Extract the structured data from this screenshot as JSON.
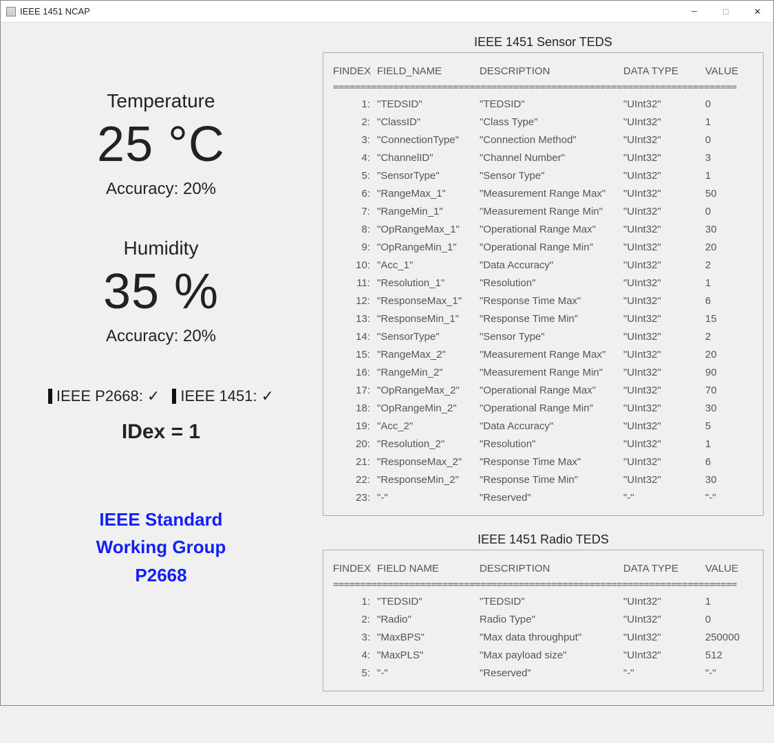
{
  "window": {
    "title": "IEEE 1451 NCAP"
  },
  "readings": {
    "temperature": {
      "label": "Temperature",
      "value": "25  °C",
      "accuracy": "Accuracy: 20%"
    },
    "humidity": {
      "label": "Humidity",
      "value": "35  %",
      "accuracy": "Accuracy: 20%"
    }
  },
  "status": {
    "p2668": {
      "label": "IEEE P2668:",
      "value": "✓"
    },
    "i1451": {
      "label": "IEEE 1451:",
      "value": "✓"
    },
    "idex": "IDex =   1"
  },
  "branding": {
    "line1": "IEEE Standard",
    "line2": "Working Group",
    "line3": "P2668"
  },
  "sensor_teds": {
    "title": "IEEE 1451 Sensor TEDS",
    "columns": [
      "FINDEX",
      "FIELD_NAME",
      "DESCRIPTION",
      "DATA TYPE",
      "VALUE"
    ],
    "rows": [
      {
        "idx": "1:",
        "name": "\"TEDSID\"",
        "desc": "\"TEDSID\"",
        "type": "\"UInt32\"",
        "value": "0"
      },
      {
        "idx": "2:",
        "name": "\"ClassID\"",
        "desc": "\"Class Type\"",
        "type": "\"UInt32\"",
        "value": "1"
      },
      {
        "idx": "3:",
        "name": "\"ConnectionType\"",
        "desc": "\"Connection Method\"",
        "type": "\"UInt32\"",
        "value": "0"
      },
      {
        "idx": "4:",
        "name": "\"ChannelID\"",
        "desc": "\"Channel Number\"",
        "type": "\"UInt32\"",
        "value": "3"
      },
      {
        "idx": "5:",
        "name": "\"SensorType\"",
        "desc": "\"Sensor Type\"",
        "type": "\"UInt32\"",
        "value": "1"
      },
      {
        "idx": "6:",
        "name": "\"RangeMax_1\"",
        "desc": "\"Measurement Range Max\"",
        "type": "\"UInt32\"",
        "value": "50"
      },
      {
        "idx": "7:",
        "name": "\"RangeMin_1\"",
        "desc": "\"Measurement Range Min\"",
        "type": "\"UInt32\"",
        "value": "0"
      },
      {
        "idx": "8:",
        "name": "\"OpRangeMax_1\"",
        "desc": "\"Operational Range Max\"",
        "type": "\"UInt32\"",
        "value": "30"
      },
      {
        "idx": "9:",
        "name": "\"OpRangeMin_1\"",
        "desc": "\"Operational Range Min\"",
        "type": "\"UInt32\"",
        "value": "20"
      },
      {
        "idx": "10:",
        "name": "\"Acc_1\"",
        "desc": "\"Data Accuracy\"",
        "type": "\"UInt32\"",
        "value": "2"
      },
      {
        "idx": "11:",
        "name": "\"Resolution_1\"",
        "desc": "\"Resolution\"",
        "type": "\"UInt32\"",
        "value": "1"
      },
      {
        "idx": "12:",
        "name": "\"ResponseMax_1\"",
        "desc": "\"Response Time Max\"",
        "type": "\"UInt32\"",
        "value": "6"
      },
      {
        "idx": "13:",
        "name": "\"ResponseMin_1\"",
        "desc": "\"Response Time Min\"",
        "type": "\"UInt32\"",
        "value": "15"
      },
      {
        "idx": "14:",
        "name": "\"SensorType\"",
        "desc": "\"Sensor Type\"",
        "type": "\"UInt32\"",
        "value": "2"
      },
      {
        "idx": "15:",
        "name": "\"RangeMax_2\"",
        "desc": "\"Measurement Range Max\"",
        "type": "\"UInt32\"",
        "value": "20"
      },
      {
        "idx": "16:",
        "name": "\"RangeMin_2\"",
        "desc": "\"Measurement Range Min\"",
        "type": "\"UInt32\"",
        "value": "90"
      },
      {
        "idx": "17:",
        "name": "\"OpRangeMax_2\"",
        "desc": "\"Operational Range Max\"",
        "type": "\"UInt32\"",
        "value": "70"
      },
      {
        "idx": "18:",
        "name": "\"OpRangeMin_2\"",
        "desc": "\"Operational Range Min\"",
        "type": "\"UInt32\"",
        "value": "30"
      },
      {
        "idx": "19:",
        "name": "\"Acc_2\"",
        "desc": "\"Data Accuracy\"",
        "type": "\"UInt32\"",
        "value": "5"
      },
      {
        "idx": "20:",
        "name": "\"Resolution_2\"",
        "desc": "\"Resolution\"",
        "type": "\"UInt32\"",
        "value": "1"
      },
      {
        "idx": "21:",
        "name": "\"ResponseMax_2\"",
        "desc": "\"Response Time Max\"",
        "type": "\"UInt32\"",
        "value": "6"
      },
      {
        "idx": "22:",
        "name": "\"ResponseMin_2\"",
        "desc": "\"Response Time Min\"",
        "type": "\"UInt32\"",
        "value": "30"
      },
      {
        "idx": "23:",
        "name": "\"-\"",
        "desc": "\"Reserved\"",
        "type": "\"-\"",
        "value": "\"-\""
      }
    ]
  },
  "radio_teds": {
    "title": "IEEE 1451 Radio TEDS",
    "columns": [
      "FINDEX",
      "FIELD NAME",
      "DESCRIPTION",
      "DATA TYPE",
      "VALUE"
    ],
    "rows": [
      {
        "idx": "1:",
        "name": "\"TEDSID\"",
        "desc": "\"TEDSID\"",
        "type": "\"UInt32\"",
        "value": "1"
      },
      {
        "idx": "2:",
        "name": "\"Radio\"",
        "desc": "Radio Type\"",
        "type": "\"UInt32\"",
        "value": "0"
      },
      {
        "idx": "3:",
        "name": "\"MaxBPS\"",
        "desc": "\"Max data throughput\"",
        "type": "\"UInt32\"",
        "value": "250000"
      },
      {
        "idx": "4:",
        "name": "\"MaxPLS\"",
        "desc": "\"Max payload size\"",
        "type": "\"UInt32\"",
        "value": "512"
      },
      {
        "idx": "5:",
        "name": "\"-\"",
        "desc": "\"Reserved\"",
        "type": "\"-\"",
        "value": "\"-\""
      }
    ]
  },
  "sep": "=========================================================================="
}
